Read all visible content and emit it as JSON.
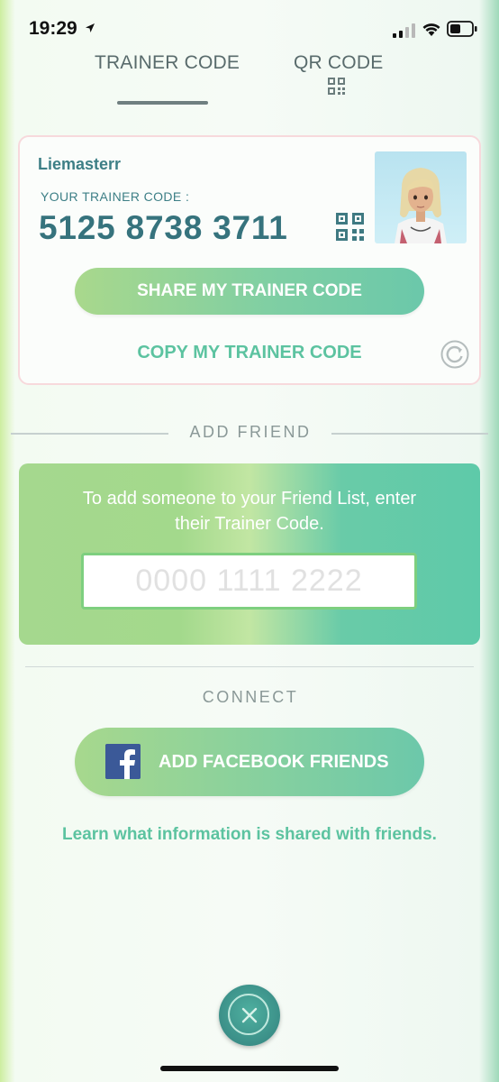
{
  "status_bar": {
    "time": "19:29"
  },
  "tabs": [
    {
      "label": "TRAINER CODE",
      "active": true
    },
    {
      "label": "QR CODE",
      "active": false
    }
  ],
  "trainer": {
    "username": "Liemasterr",
    "code_label": "YOUR TRAINER CODE :",
    "code": "5125 8738 3711",
    "share_label": "SHARE MY TRAINER CODE",
    "copy_label": "COPY MY TRAINER CODE"
  },
  "add_friend": {
    "title": "ADD FRIEND",
    "instructions": "To add someone to your Friend List, enter their Trainer Code.",
    "input_value": "",
    "input_placeholder": "0000 1111 2222"
  },
  "connect": {
    "title": "CONNECT",
    "facebook_label": "ADD FACEBOOK FRIENDS",
    "learn_link": "Learn what information is shared with friends."
  },
  "icons": {
    "location": "location-arrow-icon",
    "signal": "cellular-signal-icon",
    "wifi": "wifi-icon",
    "battery": "battery-icon",
    "qr": "qr-code-icon",
    "refresh": "refresh-icon",
    "facebook": "facebook-icon",
    "close": "close-icon"
  },
  "colors": {
    "accent_green": "#5cc3a0",
    "code_teal": "#36737d",
    "close_button": "#3b8f88",
    "facebook_blue": "#3b5998"
  }
}
